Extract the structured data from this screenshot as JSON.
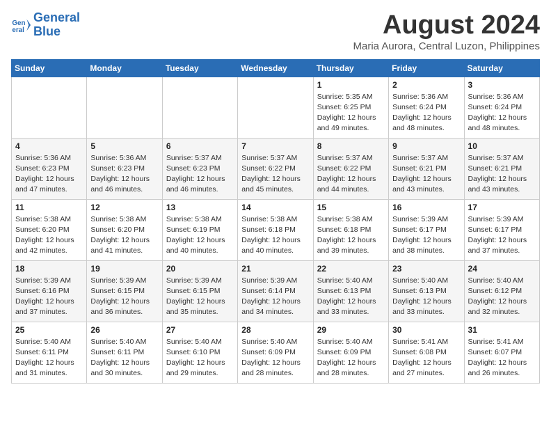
{
  "header": {
    "logo_line1": "General",
    "logo_line2": "Blue",
    "month_year": "August 2024",
    "location": "Maria Aurora, Central Luzon, Philippines"
  },
  "weekdays": [
    "Sunday",
    "Monday",
    "Tuesday",
    "Wednesday",
    "Thursday",
    "Friday",
    "Saturday"
  ],
  "weeks": [
    [
      {
        "day": "",
        "info": ""
      },
      {
        "day": "",
        "info": ""
      },
      {
        "day": "",
        "info": ""
      },
      {
        "day": "",
        "info": ""
      },
      {
        "day": "1",
        "info": "Sunrise: 5:35 AM\nSunset: 6:25 PM\nDaylight: 12 hours\nand 49 minutes."
      },
      {
        "day": "2",
        "info": "Sunrise: 5:36 AM\nSunset: 6:24 PM\nDaylight: 12 hours\nand 48 minutes."
      },
      {
        "day": "3",
        "info": "Sunrise: 5:36 AM\nSunset: 6:24 PM\nDaylight: 12 hours\nand 48 minutes."
      }
    ],
    [
      {
        "day": "4",
        "info": "Sunrise: 5:36 AM\nSunset: 6:23 PM\nDaylight: 12 hours\nand 47 minutes."
      },
      {
        "day": "5",
        "info": "Sunrise: 5:36 AM\nSunset: 6:23 PM\nDaylight: 12 hours\nand 46 minutes."
      },
      {
        "day": "6",
        "info": "Sunrise: 5:37 AM\nSunset: 6:23 PM\nDaylight: 12 hours\nand 46 minutes."
      },
      {
        "day": "7",
        "info": "Sunrise: 5:37 AM\nSunset: 6:22 PM\nDaylight: 12 hours\nand 45 minutes."
      },
      {
        "day": "8",
        "info": "Sunrise: 5:37 AM\nSunset: 6:22 PM\nDaylight: 12 hours\nand 44 minutes."
      },
      {
        "day": "9",
        "info": "Sunrise: 5:37 AM\nSunset: 6:21 PM\nDaylight: 12 hours\nand 43 minutes."
      },
      {
        "day": "10",
        "info": "Sunrise: 5:37 AM\nSunset: 6:21 PM\nDaylight: 12 hours\nand 43 minutes."
      }
    ],
    [
      {
        "day": "11",
        "info": "Sunrise: 5:38 AM\nSunset: 6:20 PM\nDaylight: 12 hours\nand 42 minutes."
      },
      {
        "day": "12",
        "info": "Sunrise: 5:38 AM\nSunset: 6:20 PM\nDaylight: 12 hours\nand 41 minutes."
      },
      {
        "day": "13",
        "info": "Sunrise: 5:38 AM\nSunset: 6:19 PM\nDaylight: 12 hours\nand 40 minutes."
      },
      {
        "day": "14",
        "info": "Sunrise: 5:38 AM\nSunset: 6:18 PM\nDaylight: 12 hours\nand 40 minutes."
      },
      {
        "day": "15",
        "info": "Sunrise: 5:38 AM\nSunset: 6:18 PM\nDaylight: 12 hours\nand 39 minutes."
      },
      {
        "day": "16",
        "info": "Sunrise: 5:39 AM\nSunset: 6:17 PM\nDaylight: 12 hours\nand 38 minutes."
      },
      {
        "day": "17",
        "info": "Sunrise: 5:39 AM\nSunset: 6:17 PM\nDaylight: 12 hours\nand 37 minutes."
      }
    ],
    [
      {
        "day": "18",
        "info": "Sunrise: 5:39 AM\nSunset: 6:16 PM\nDaylight: 12 hours\nand 37 minutes."
      },
      {
        "day": "19",
        "info": "Sunrise: 5:39 AM\nSunset: 6:15 PM\nDaylight: 12 hours\nand 36 minutes."
      },
      {
        "day": "20",
        "info": "Sunrise: 5:39 AM\nSunset: 6:15 PM\nDaylight: 12 hours\nand 35 minutes."
      },
      {
        "day": "21",
        "info": "Sunrise: 5:39 AM\nSunset: 6:14 PM\nDaylight: 12 hours\nand 34 minutes."
      },
      {
        "day": "22",
        "info": "Sunrise: 5:40 AM\nSunset: 6:13 PM\nDaylight: 12 hours\nand 33 minutes."
      },
      {
        "day": "23",
        "info": "Sunrise: 5:40 AM\nSunset: 6:13 PM\nDaylight: 12 hours\nand 33 minutes."
      },
      {
        "day": "24",
        "info": "Sunrise: 5:40 AM\nSunset: 6:12 PM\nDaylight: 12 hours\nand 32 minutes."
      }
    ],
    [
      {
        "day": "25",
        "info": "Sunrise: 5:40 AM\nSunset: 6:11 PM\nDaylight: 12 hours\nand 31 minutes."
      },
      {
        "day": "26",
        "info": "Sunrise: 5:40 AM\nSunset: 6:11 PM\nDaylight: 12 hours\nand 30 minutes."
      },
      {
        "day": "27",
        "info": "Sunrise: 5:40 AM\nSunset: 6:10 PM\nDaylight: 12 hours\nand 29 minutes."
      },
      {
        "day": "28",
        "info": "Sunrise: 5:40 AM\nSunset: 6:09 PM\nDaylight: 12 hours\nand 28 minutes."
      },
      {
        "day": "29",
        "info": "Sunrise: 5:40 AM\nSunset: 6:09 PM\nDaylight: 12 hours\nand 28 minutes."
      },
      {
        "day": "30",
        "info": "Sunrise: 5:41 AM\nSunset: 6:08 PM\nDaylight: 12 hours\nand 27 minutes."
      },
      {
        "day": "31",
        "info": "Sunrise: 5:41 AM\nSunset: 6:07 PM\nDaylight: 12 hours\nand 26 minutes."
      }
    ]
  ]
}
